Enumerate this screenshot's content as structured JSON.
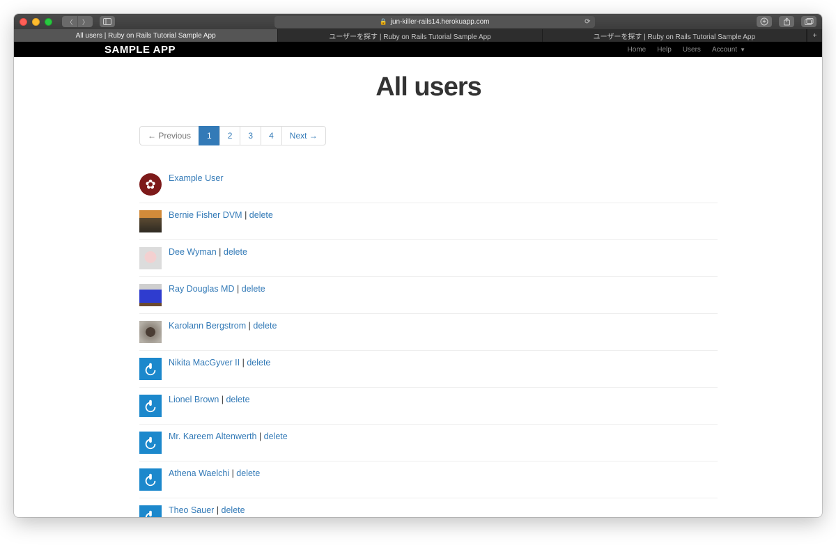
{
  "browser": {
    "url": "jun-killer-rails14.herokuapp.com",
    "tabs": [
      "All users | Ruby on Rails Tutorial Sample App",
      "ユーザーを探す | Ruby on Rails Tutorial Sample App",
      "ユーザーを探す | Ruby on Rails Tutorial Sample App"
    ],
    "active_tab": 0
  },
  "app": {
    "brand": "SAMPLE APP",
    "nav": {
      "home": "Home",
      "help": "Help",
      "users": "Users",
      "account": "Account"
    }
  },
  "page": {
    "title": "All users"
  },
  "pagination": {
    "prev": "← Previous",
    "pages": [
      "1",
      "2",
      "3",
      "4"
    ],
    "next": "Next →",
    "current": "1"
  },
  "list": {
    "separator": " | ",
    "delete_label": "delete"
  },
  "users": [
    {
      "name": "Example User",
      "deletable": false,
      "avatar": "badge"
    },
    {
      "name": "Bernie Fisher DVM",
      "deletable": true,
      "avatar": "photo1"
    },
    {
      "name": "Dee Wyman",
      "deletable": true,
      "avatar": "photo2"
    },
    {
      "name": "Ray Douglas MD",
      "deletable": true,
      "avatar": "photo3"
    },
    {
      "name": "Karolann Bergstrom",
      "deletable": true,
      "avatar": "photo4"
    },
    {
      "name": "Nikita MacGyver II",
      "deletable": true,
      "avatar": "grav"
    },
    {
      "name": "Lionel Brown",
      "deletable": true,
      "avatar": "grav"
    },
    {
      "name": "Mr. Kareem Altenwerth",
      "deletable": true,
      "avatar": "grav"
    },
    {
      "name": "Athena Waelchi",
      "deletable": true,
      "avatar": "grav"
    },
    {
      "name": "Theo Sauer",
      "deletable": true,
      "avatar": "grav"
    }
  ]
}
